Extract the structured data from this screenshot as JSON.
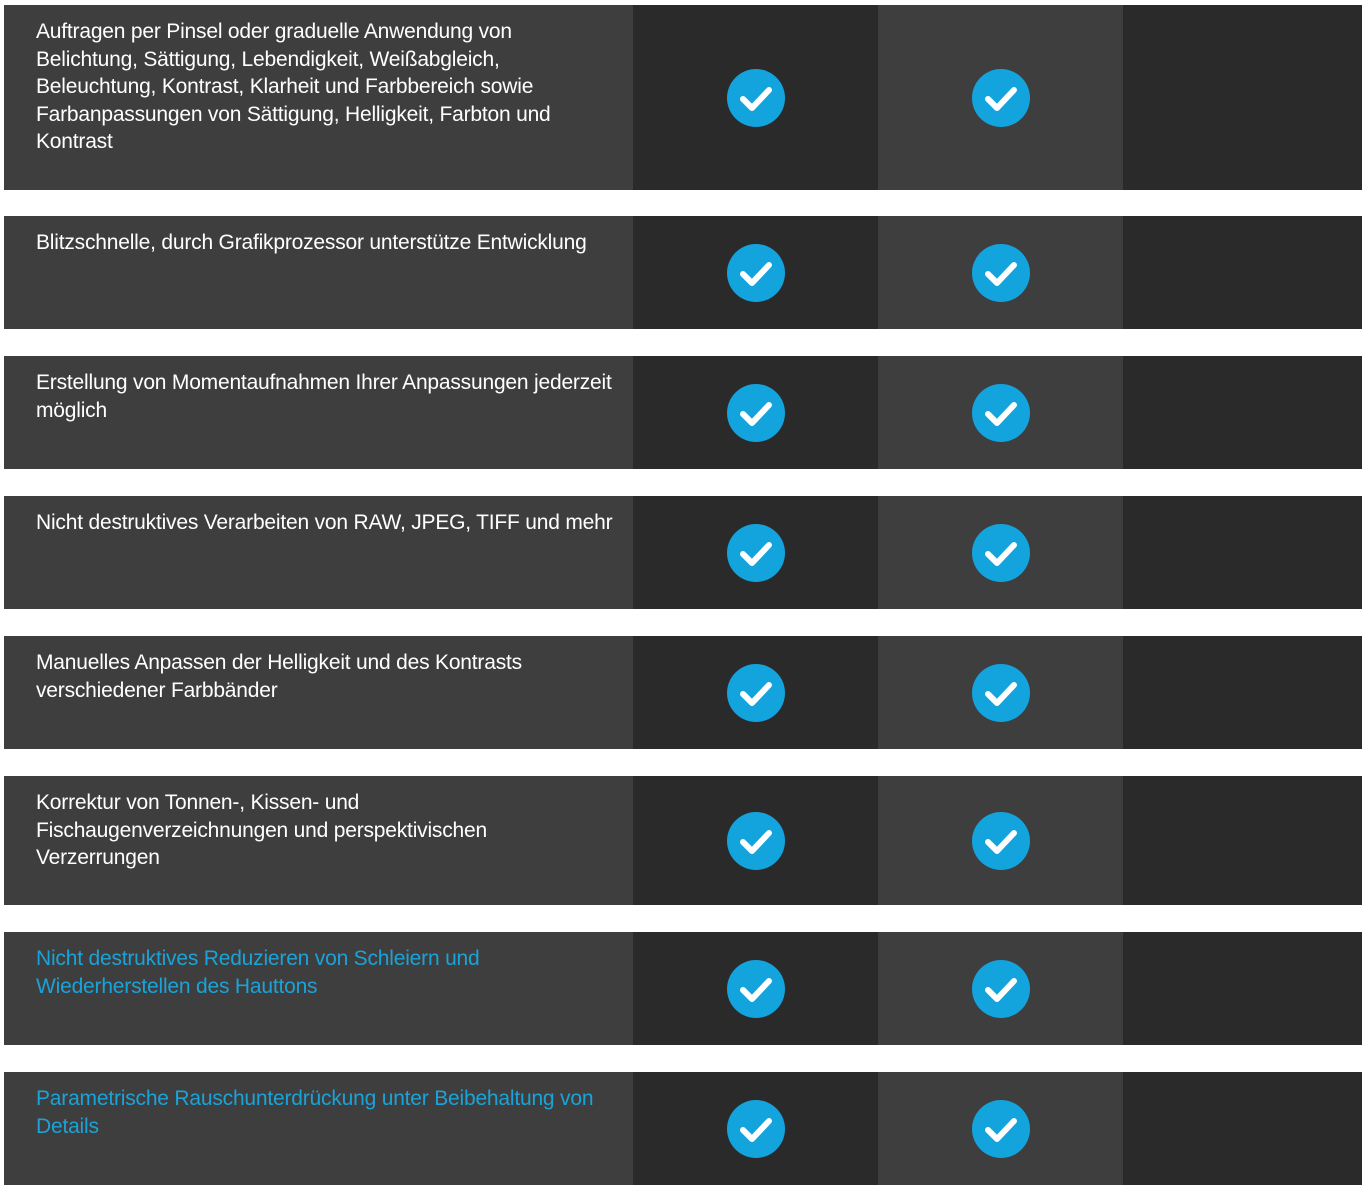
{
  "colors": {
    "label_bg": "#3e3e3e",
    "dark_col_bg": "#2a2a2a",
    "check_circle": "#13a3dd",
    "link_text": "#1aa3d9",
    "text": "#ffffff"
  },
  "rows": [
    {
      "label": "Auftragen per Pinsel oder graduelle Anwendung von Belichtung, Sättigung, Lebendigkeit, Weißabgleich, Beleuchtung, Kontrast, Klarheit und Farbbereich sowie Farbanpassungen von Sättigung, Helligkeit, Farbton und Kontrast",
      "link": false,
      "col1": "check-circle-icon",
      "col2": "check-circle-icon"
    },
    {
      "label": "Blitzschnelle, durch Grafikprozessor unterstütze Entwicklung",
      "link": false,
      "col1": "check-circle-icon",
      "col2": "check-circle-icon"
    },
    {
      "label": "Erstellung von Momentaufnahmen Ihrer Anpassungen jederzeit möglich",
      "link": false,
      "col1": "check-circle-icon",
      "col2": "check-circle-icon"
    },
    {
      "label": "Nicht destruktives Verarbeiten von RAW, JPEG, TIFF und mehr",
      "link": false,
      "col1": "check-circle-icon",
      "col2": "check-circle-icon"
    },
    {
      "label": "Manuelles Anpassen der Helligkeit und des Kontrasts verschiedener Farbbänder",
      "link": false,
      "col1": "check-circle-icon",
      "col2": "check-circle-icon"
    },
    {
      "label": "Korrektur von Tonnen-, Kissen- und Fischaugenverzeichnungen und perspektivischen Verzerrungen",
      "link": false,
      "col1": "check-circle-icon",
      "col2": "check-circle-icon"
    },
    {
      "label": "Nicht destruktives Reduzieren von Schleiern und Wiederherstellen des Hauttons",
      "link": true,
      "col1": "check-circle-icon",
      "col2": "check-circle-icon"
    },
    {
      "label": "Parametrische Rauschunterdrückung unter Beibehaltung von Details",
      "link": true,
      "col1": "check-circle-icon",
      "col2": "check-circle-icon"
    }
  ]
}
